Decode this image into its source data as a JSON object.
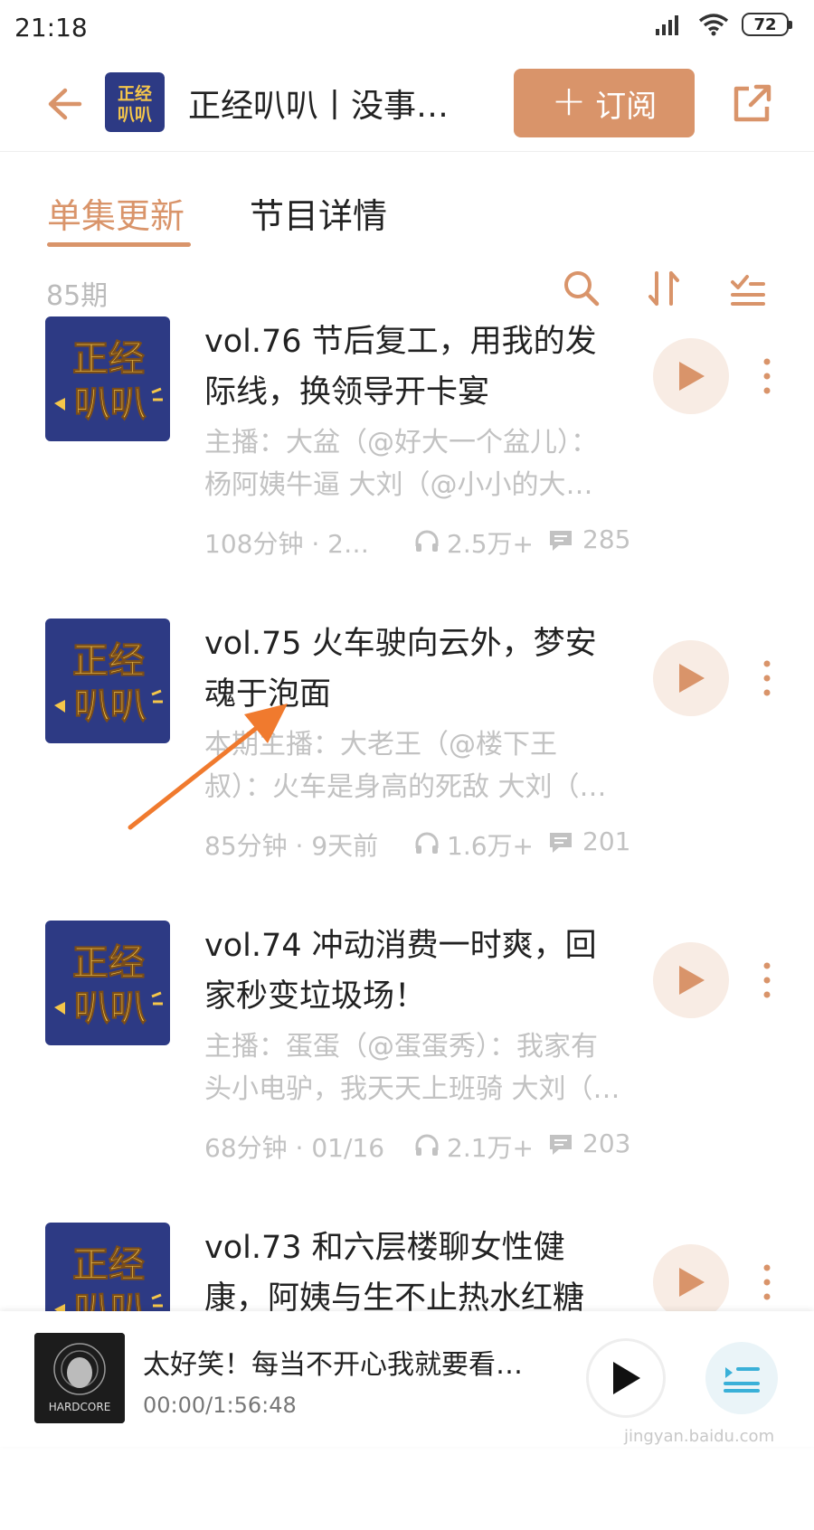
{
  "status_bar": {
    "time": "21:18",
    "battery": "72"
  },
  "header": {
    "title": "正经叭叭丨没事…",
    "subscribe_label": "订阅",
    "cover_text_top": "正经",
    "cover_text_bottom": "叭叭"
  },
  "tabs": [
    {
      "label": "单集更新",
      "active": true
    },
    {
      "label": "节目详情",
      "active": false
    }
  ],
  "toolbar": {
    "count": "85期"
  },
  "episodes": [
    {
      "title": "vol.76 节后复工，用我的发际线，换领导开卡宴",
      "desc_line1": "主播：大盆（@好大一个盆儿）：",
      "desc_line2": "杨阿姨牛逼 大刘（@小小的大…",
      "duration": "108分钟 · 2天…",
      "listens": "2.5万+",
      "comments": "285"
    },
    {
      "title": "vol.75 火车驶向云外，梦安魂于泡面",
      "desc_line1": "本期主播：大老王（@楼下王",
      "desc_line2": "叔）：火车是身高的死敌 大刘（…",
      "duration": "85分钟 · 9天前",
      "listens": "1.6万+",
      "comments": "201"
    },
    {
      "title": "vol.74 冲动消费一时爽，回家秒变垃圾场！",
      "desc_line1": "主播：蛋蛋（@蛋蛋秀）：我家有",
      "desc_line2": "头小电驴，我天天上班骑 大刘（…",
      "duration": "68分钟 · 01/16",
      "listens": "2.1万+",
      "comments": "203"
    },
    {
      "title": "vol.73 和六层楼聊女性健康，阿姨与生不止热水红糖",
      "desc_line1": "",
      "desc_line2": "",
      "duration": "",
      "listens": "",
      "comments": ""
    }
  ],
  "mini_player": {
    "title": "太好笑！每当不开心我就要看…",
    "time": "00:00/1:56:48",
    "cover_text": "HARDCORE"
  },
  "watermark": "jingyan.baidu.com",
  "colors": {
    "accent": "#d9946a",
    "cover_bg": "#2d3a84",
    "cover_text": "#f5c64a"
  }
}
